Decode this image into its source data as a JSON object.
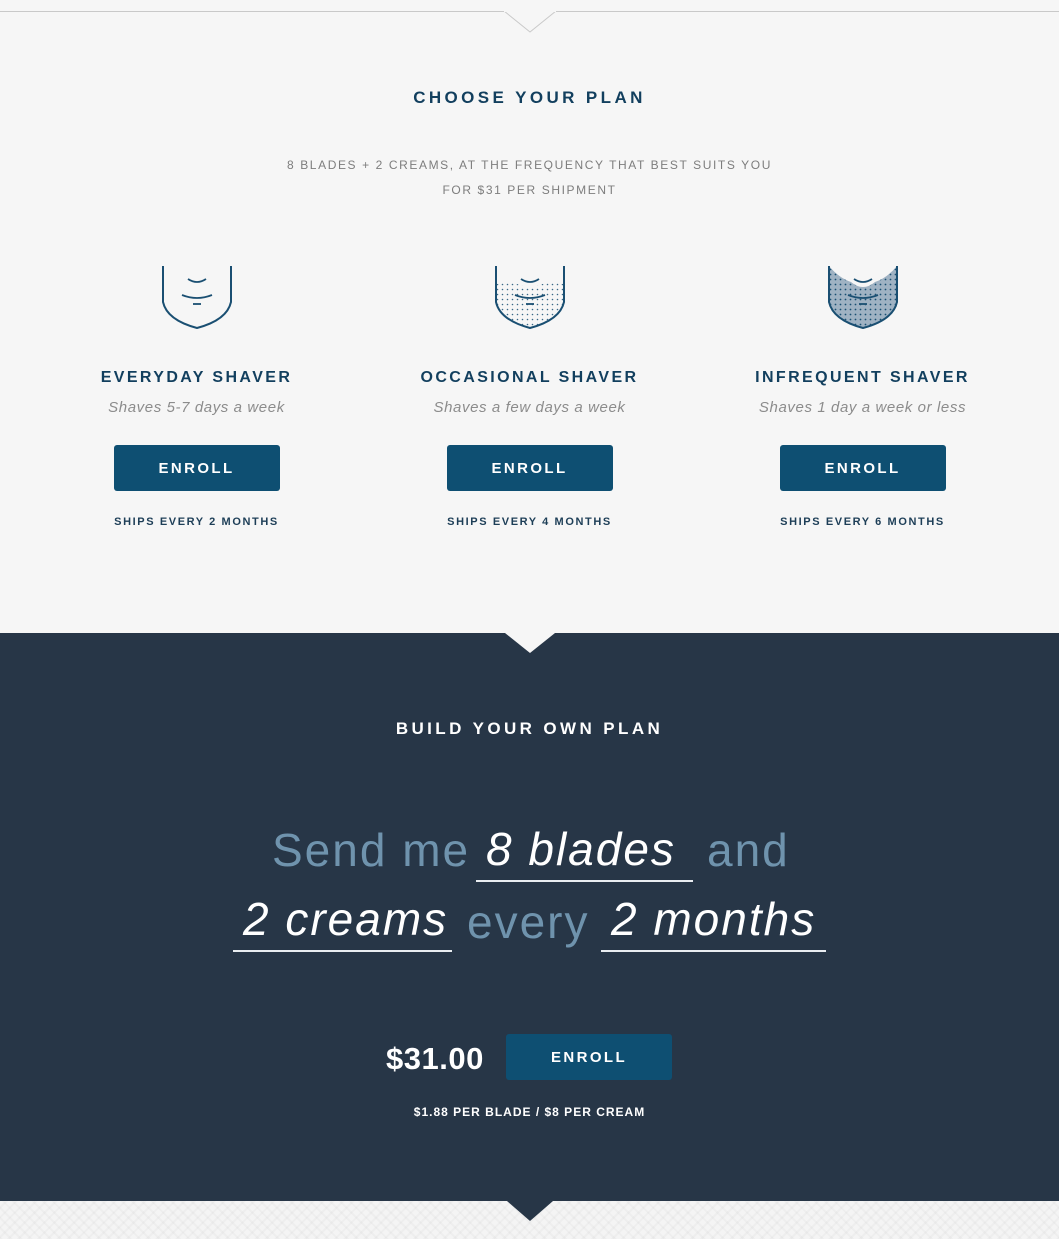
{
  "choose_plan": {
    "title": "CHOOSE YOUR PLAN",
    "subtitle_line1": "8 BLADES + 2 CREAMS, AT THE FREQUENCY THAT BEST SUITS YOU",
    "subtitle_line2": "FOR $31 PER SHIPMENT",
    "plans": [
      {
        "icon": "clean-shaven-face-icon",
        "name": "EVERYDAY SHAVER",
        "description": "Shaves 5-7 days a week",
        "button": "ENROLL",
        "ships": "SHIPS EVERY 2 MONTHS"
      },
      {
        "icon": "stubble-face-icon",
        "name": "OCCASIONAL SHAVER",
        "description": "Shaves a few days a week",
        "button": "ENROLL",
        "ships": "SHIPS EVERY 4 MONTHS"
      },
      {
        "icon": "beard-face-icon",
        "name": "INFREQUENT SHAVER",
        "description": "Shaves 1 day a week or less",
        "button": "ENROLL",
        "ships": "SHIPS EVERY 6 MONTHS"
      }
    ]
  },
  "build_plan": {
    "title": "BUILD YOUR OWN PLAN",
    "sentence": {
      "send_me": "Send me",
      "blades": "8 blades",
      "and": "and",
      "creams": "2 creams",
      "every": "every",
      "frequency": "2 months"
    },
    "price": "$31.00",
    "button": "ENROLL",
    "unit_price": "$1.88 PER BLADE / $8 PER CREAM"
  },
  "colors": {
    "navy_text": "#123f5e",
    "button_blue": "#0e4f72",
    "dark_section": "#273647",
    "light_background": "#f6f6f6",
    "muted_blue_text": "#6f93ad"
  }
}
